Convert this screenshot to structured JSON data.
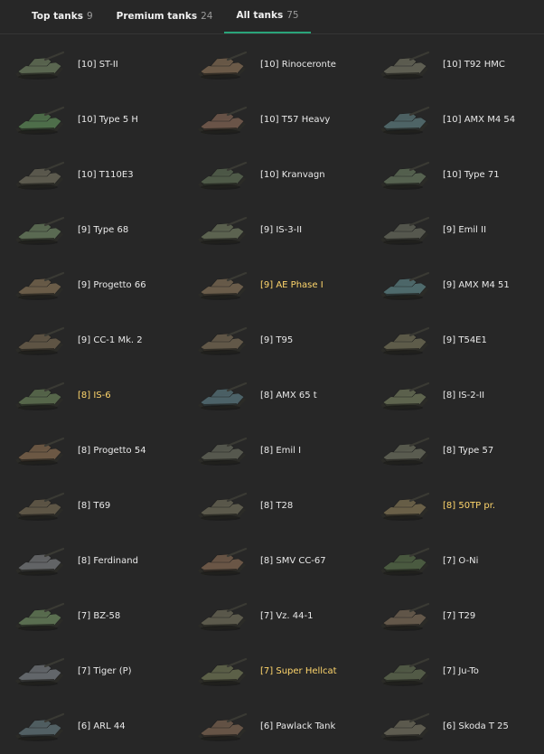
{
  "tabs": [
    {
      "label": "Top tanks",
      "count": "9",
      "active": false
    },
    {
      "label": "Premium tanks",
      "count": "24",
      "active": false
    },
    {
      "label": "All tanks",
      "count": "75",
      "active": true
    }
  ],
  "colors": {
    "accent": "#2aa47a",
    "premium": "#ffd66c",
    "text": "#e9e9e9"
  },
  "tanks": [
    {
      "name": "[10] ST-II",
      "premium": false,
      "color": "#5a6650"
    },
    {
      "name": "[10] Rinoceronte",
      "premium": false,
      "color": "#6b5a48"
    },
    {
      "name": "[10] T92 HMC",
      "premium": false,
      "color": "#5e5e52"
    },
    {
      "name": "[10] Type 5 H",
      "premium": false,
      "color": "#4e6e4a"
    },
    {
      "name": "[10] T57 Heavy",
      "premium": false,
      "color": "#6a5448"
    },
    {
      "name": "[10] AMX M4 54",
      "premium": false,
      "color": "#4e6466"
    },
    {
      "name": "[10] T110E3",
      "premium": false,
      "color": "#5c5a4e"
    },
    {
      "name": "[10] Kranvagn",
      "premium": false,
      "color": "#4f5a48"
    },
    {
      "name": "[10] Type 71",
      "premium": false,
      "color": "#566250"
    },
    {
      "name": "[9] Type 68",
      "premium": false,
      "color": "#5a6a52"
    },
    {
      "name": "[9] IS-3-II",
      "premium": false,
      "color": "#5c6350"
    },
    {
      "name": "[9] Emil II",
      "premium": false,
      "color": "#56584e"
    },
    {
      "name": "[9] Progetto 66",
      "premium": false,
      "color": "#6a5c48"
    },
    {
      "name": "[9] AE Phase I",
      "premium": true,
      "color": "#6a5c4a"
    },
    {
      "name": "[9] AMX M4 51",
      "premium": false,
      "color": "#4e6a6c"
    },
    {
      "name": "[9] CC-1 Mk. 2",
      "premium": false,
      "color": "#5e5444"
    },
    {
      "name": "[9] T95",
      "premium": false,
      "color": "#625848"
    },
    {
      "name": "[9] T54E1",
      "premium": false,
      "color": "#5e5c4a"
    },
    {
      "name": "[8] IS-6",
      "premium": true,
      "color": "#56664a"
    },
    {
      "name": "[8] AMX 65 t",
      "premium": false,
      "color": "#4c6268"
    },
    {
      "name": "[8] IS-2-II",
      "premium": false,
      "color": "#5e644e"
    },
    {
      "name": "[8] Progetto 54",
      "premium": false,
      "color": "#6c5844"
    },
    {
      "name": "[8] Emil I",
      "premium": false,
      "color": "#56584e"
    },
    {
      "name": "[8] Type 57",
      "premium": false,
      "color": "#5a5c50"
    },
    {
      "name": "[8] T69",
      "premium": false,
      "color": "#5e5646"
    },
    {
      "name": "[8] T28",
      "premium": false,
      "color": "#5c5a4c"
    },
    {
      "name": "[8] 50TP pr.",
      "premium": true,
      "color": "#6a6048"
    },
    {
      "name": "[8] Ferdinand",
      "premium": false,
      "color": "#626466"
    },
    {
      "name": "[8] SMV CC-67",
      "premium": false,
      "color": "#6a5646"
    },
    {
      "name": "[7] O-Ni",
      "premium": false,
      "color": "#4a5a40"
    },
    {
      "name": "[7] BZ-58",
      "premium": false,
      "color": "#5a6e50"
    },
    {
      "name": "[7] Vz. 44-1",
      "premium": false,
      "color": "#5c5a4c"
    },
    {
      "name": "[7] T29",
      "premium": false,
      "color": "#64584a"
    },
    {
      "name": "[7] Tiger (P)",
      "premium": false,
      "color": "#62666a"
    },
    {
      "name": "[7] Super Hellcat",
      "premium": true,
      "color": "#5c6048"
    },
    {
      "name": "[7] Ju-To",
      "premium": false,
      "color": "#525a46"
    },
    {
      "name": "[6] ARL 44",
      "premium": false,
      "color": "#526064"
    },
    {
      "name": "[6] Pawlack Tank",
      "premium": false,
      "color": "#665446"
    },
    {
      "name": "[6] Skoda T 25",
      "premium": false,
      "color": "#5e5c50"
    }
  ]
}
